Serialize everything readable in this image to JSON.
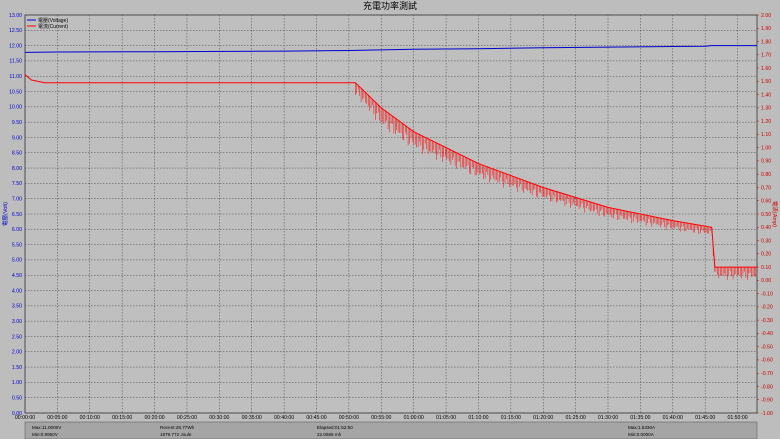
{
  "window": {
    "title": "充電功率測試"
  },
  "chart_data": {
    "type": "line",
    "title": "充電功率測試",
    "x": {
      "label": "",
      "ticks": [
        "00:00:00",
        "00:05:00",
        "00:10:00",
        "00:15:00",
        "00:20:00",
        "00:25:00",
        "00:30:00",
        "00:35:00",
        "00:40:00",
        "00:45:00",
        "00:50:00",
        "00:55:00",
        "01:00:00",
        "01:05:00",
        "01:10:00",
        "01:15:00",
        "01:20:00",
        "01:25:00",
        "01:30:00",
        "01:35:00",
        "01:40:00",
        "01:45:00",
        "01:50:00"
      ],
      "range_minutes": [
        0,
        113
      ]
    },
    "y_left": {
      "label": "電壓(Volt)",
      "range": [
        0,
        13
      ],
      "ticks": [
        "0.00",
        "0.50",
        "1.00",
        "1.50",
        "2.00",
        "2.50",
        "3.00",
        "3.50",
        "4.00",
        "4.50",
        "5.00",
        "5.50",
        "6.00",
        "6.50",
        "7.00",
        "7.50",
        "8.00",
        "8.50",
        "9.00",
        "9.50",
        "10.00",
        "10.50",
        "11.00",
        "11.50",
        "12.00",
        "12.50",
        "13.00"
      ]
    },
    "y_right": {
      "label": "電流(Amp)",
      "range": [
        -1.0,
        2.0
      ],
      "ticks": [
        "-1.00",
        "-0.90",
        "-0.80",
        "-0.70",
        "-0.60",
        "-0.50",
        "-0.40",
        "-0.30",
        "-0.20",
        "-0.10",
        "0.00",
        "0.10",
        "0.20",
        "0.30",
        "0.40",
        "0.50",
        "0.60",
        "0.70",
        "0.80",
        "0.90",
        "1.00",
        "1.10",
        "1.20",
        "1.30",
        "1.40",
        "1.50",
        "1.60",
        "1.70",
        "1.80",
        "1.90",
        "2.00"
      ]
    },
    "grid": true,
    "legend_position": "top-left",
    "series": [
      {
        "name": "電壓(Voltage)",
        "axis": "left",
        "color": "#0000cc",
        "points": [
          [
            0,
            11.78
          ],
          [
            5,
            11.79
          ],
          [
            20,
            11.8
          ],
          [
            40,
            11.82
          ],
          [
            50,
            11.84
          ],
          [
            55,
            11.86
          ],
          [
            60,
            11.88
          ],
          [
            70,
            11.9
          ],
          [
            80,
            11.93
          ],
          [
            90,
            11.95
          ],
          [
            100,
            11.97
          ],
          [
            105,
            11.98
          ],
          [
            106,
            12.0
          ],
          [
            113,
            12.0
          ]
        ]
      },
      {
        "name": "電流(Current)",
        "axis": "right",
        "color": "#ff0000",
        "points": [
          [
            0,
            1.55
          ],
          [
            1,
            1.51
          ],
          [
            3,
            1.49
          ],
          [
            20,
            1.49
          ],
          [
            40,
            1.49
          ],
          [
            51,
            1.49
          ],
          [
            55,
            1.3
          ],
          [
            60,
            1.12
          ],
          [
            70,
            0.88
          ],
          [
            80,
            0.7
          ],
          [
            90,
            0.55
          ],
          [
            100,
            0.45
          ],
          [
            106,
            0.4
          ],
          [
            106.5,
            0.1
          ],
          [
            113,
            0.1
          ]
        ],
        "fluctuation_band": [
          [
            51,
            0.1
          ],
          [
            55,
            0.15
          ],
          [
            60,
            0.14
          ],
          [
            70,
            0.12
          ],
          [
            80,
            0.1
          ],
          [
            90,
            0.09
          ],
          [
            100,
            0.08
          ],
          [
            106,
            0.07
          ],
          [
            106.5,
            0.1
          ],
          [
            113,
            0.1
          ]
        ]
      }
    ],
    "stats_bar": [
      {
        "label": "Max:11.0000V",
        "sub": "Min:0.9950V"
      },
      {
        "label": "Recent:28.77Wh",
        "sub": "1879.772 Joule"
      },
      {
        "label": "Elapsed:01:52:50",
        "sub": "22.0668 mh"
      },
      {
        "label": "Max:1.5330A",
        "sub": "Min:0.0000A"
      }
    ]
  }
}
